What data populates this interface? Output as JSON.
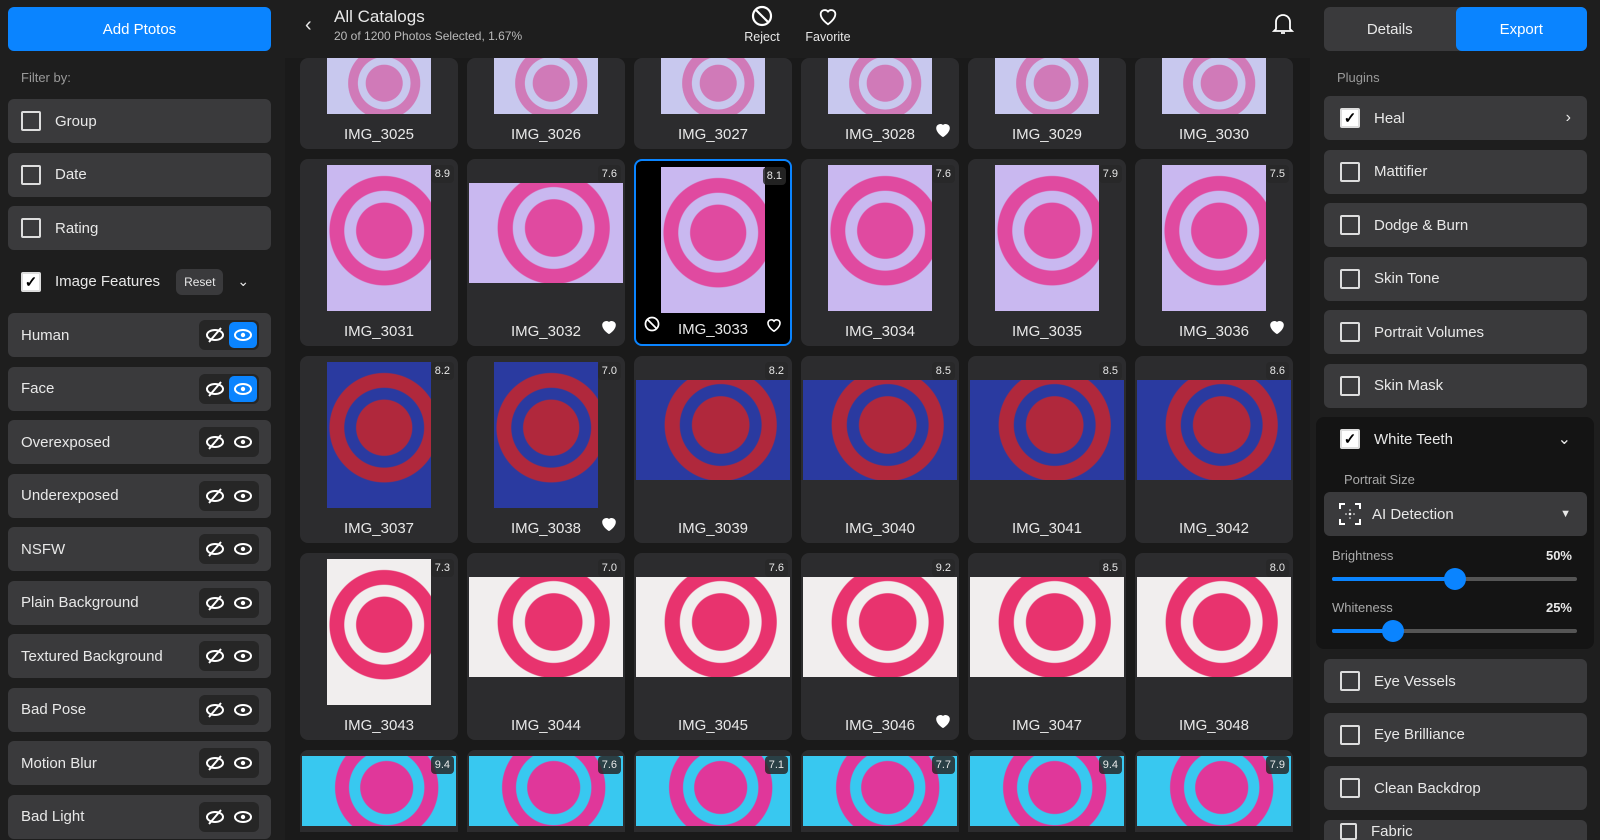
{
  "left": {
    "add_button": "Add Ptotos",
    "filter_label": "Filter by:",
    "filters": [
      {
        "label": "Group",
        "checked": false
      },
      {
        "label": "Date",
        "checked": false
      },
      {
        "label": "Rating",
        "checked": false
      }
    ],
    "image_features": {
      "label": "Image Features",
      "checked": true,
      "reset": "Reset"
    },
    "features": [
      {
        "label": "Human",
        "visible": true
      },
      {
        "label": "Face",
        "visible": true
      },
      {
        "label": "Overexposed",
        "visible": false
      },
      {
        "label": "Underexposed",
        "visible": false
      },
      {
        "label": "NSFW",
        "visible": false
      },
      {
        "label": "Plain Background",
        "visible": false
      },
      {
        "label": "Textured Background",
        "visible": false
      },
      {
        "label": "Bad Pose",
        "visible": false
      },
      {
        "label": "Motion Blur",
        "visible": false
      },
      {
        "label": "Bad Light",
        "visible": false
      }
    ]
  },
  "header": {
    "title": "All Catalogs",
    "subtitle": "20 of 1200 Photos Selected, 1.67%",
    "reject": "Reject",
    "favorite": "Favorite"
  },
  "photos": [
    {
      "name": "IMG_3025",
      "score": "",
      "fav": false
    },
    {
      "name": "IMG_3026",
      "score": "",
      "fav": false
    },
    {
      "name": "IMG_3027",
      "score": "",
      "fav": false
    },
    {
      "name": "IMG_3028",
      "score": "",
      "fav": true
    },
    {
      "name": "IMG_3029",
      "score": "",
      "fav": false
    },
    {
      "name": "IMG_3030",
      "score": "",
      "fav": false
    },
    {
      "name": "IMG_3031",
      "score": "8.9",
      "fav": false
    },
    {
      "name": "IMG_3032",
      "score": "7.6",
      "fav": true
    },
    {
      "name": "IMG_3033",
      "score": "8.1",
      "fav": false,
      "selected": true
    },
    {
      "name": "IMG_3034",
      "score": "7.6",
      "fav": false
    },
    {
      "name": "IMG_3035",
      "score": "7.9",
      "fav": false
    },
    {
      "name": "IMG_3036",
      "score": "7.5",
      "fav": true
    },
    {
      "name": "IMG_3037",
      "score": "8.2",
      "fav": false
    },
    {
      "name": "IMG_3038",
      "score": "7.0",
      "fav": true
    },
    {
      "name": "IMG_3039",
      "score": "8.2",
      "fav": false
    },
    {
      "name": "IMG_3040",
      "score": "8.5",
      "fav": false
    },
    {
      "name": "IMG_3041",
      "score": "8.5",
      "fav": false
    },
    {
      "name": "IMG_3042",
      "score": "8.6",
      "fav": false
    },
    {
      "name": "IMG_3043",
      "score": "7.3",
      "fav": false
    },
    {
      "name": "IMG_3044",
      "score": "7.0",
      "fav": false
    },
    {
      "name": "IMG_3045",
      "score": "7.6",
      "fav": false
    },
    {
      "name": "IMG_3046",
      "score": "9.2",
      "fav": true
    },
    {
      "name": "IMG_3047",
      "score": "8.5",
      "fav": false
    },
    {
      "name": "IMG_3048",
      "score": "8.0",
      "fav": false
    },
    {
      "name": "",
      "score": "9.4",
      "fav": false
    },
    {
      "name": "",
      "score": "7.6",
      "fav": false
    },
    {
      "name": "",
      "score": "7.1",
      "fav": false
    },
    {
      "name": "",
      "score": "7.7",
      "fav": false
    },
    {
      "name": "",
      "score": "9.4",
      "fav": false
    },
    {
      "name": "",
      "score": "7.9",
      "fav": false
    }
  ],
  "right": {
    "tabs": [
      "Details",
      "Export"
    ],
    "active_tab": "Export",
    "plugins_label": "Plugins",
    "plugins_top": [
      {
        "label": "Heal",
        "checked": true
      },
      {
        "label": "Mattifier",
        "checked": false
      },
      {
        "label": "Dodge & Burn",
        "checked": false
      },
      {
        "label": "Skin Tone",
        "checked": false
      },
      {
        "label": "Portrait Volumes",
        "checked": false
      },
      {
        "label": "Skin Mask",
        "checked": false
      }
    ],
    "white_teeth": {
      "label": "White Teeth",
      "checked": true,
      "portrait_size_label": "Portrait Size",
      "portrait_size": "AI Detection",
      "brightness_label": "Brightness",
      "brightness": "50%",
      "brightness_value": 50,
      "whiteness_label": "Whiteness",
      "whiteness": "25%",
      "whiteness_value": 25
    },
    "plugins_bottom": [
      {
        "label": "Eye Vessels",
        "checked": false
      },
      {
        "label": "Eye Brilliance",
        "checked": false
      },
      {
        "label": "Clean Backdrop",
        "checked": false
      },
      {
        "label": "Fabric",
        "checked": false
      }
    ]
  },
  "colors": {
    "accent": "#0a84ff"
  }
}
